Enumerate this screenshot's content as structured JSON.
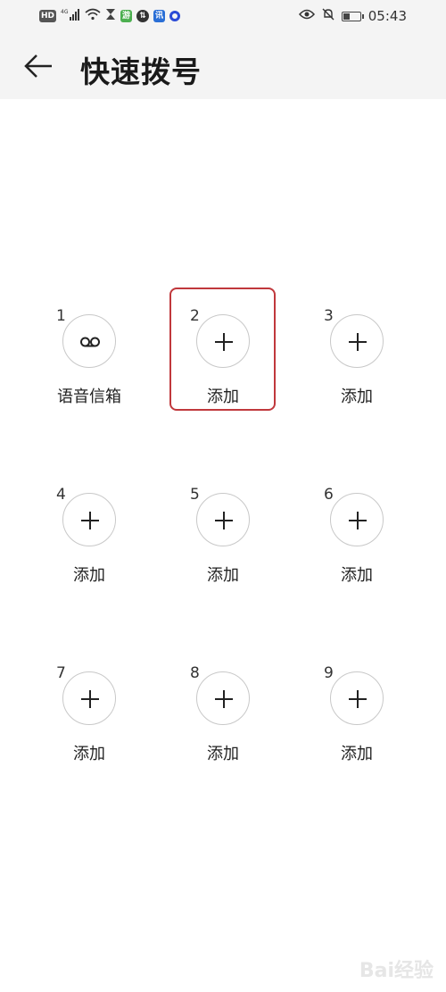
{
  "status_bar": {
    "left_badges": [
      "HD",
      "4G",
      "",
      "",
      "",
      "11",
      "",
      ""
    ],
    "time": "05:43",
    "battery_level": 0.45
  },
  "header": {
    "title": "快速拨号",
    "back_icon": "arrow-left-icon"
  },
  "speed_dials": [
    {
      "number": "1",
      "label": "语音信箱",
      "icon": "voicemail-icon"
    },
    {
      "number": "2",
      "label": "添加",
      "icon": "plus-icon"
    },
    {
      "number": "3",
      "label": "添加",
      "icon": "plus-icon"
    },
    {
      "number": "4",
      "label": "添加",
      "icon": "plus-icon"
    },
    {
      "number": "5",
      "label": "添加",
      "icon": "plus-icon"
    },
    {
      "number": "6",
      "label": "添加",
      "icon": "plus-icon"
    },
    {
      "number": "7",
      "label": "添加",
      "icon": "plus-icon"
    },
    {
      "number": "8",
      "label": "添加",
      "icon": "plus-icon"
    },
    {
      "number": "9",
      "label": "添加",
      "icon": "plus-icon"
    }
  ],
  "highlight_color": "#c0383c",
  "watermark": "Bai经验"
}
